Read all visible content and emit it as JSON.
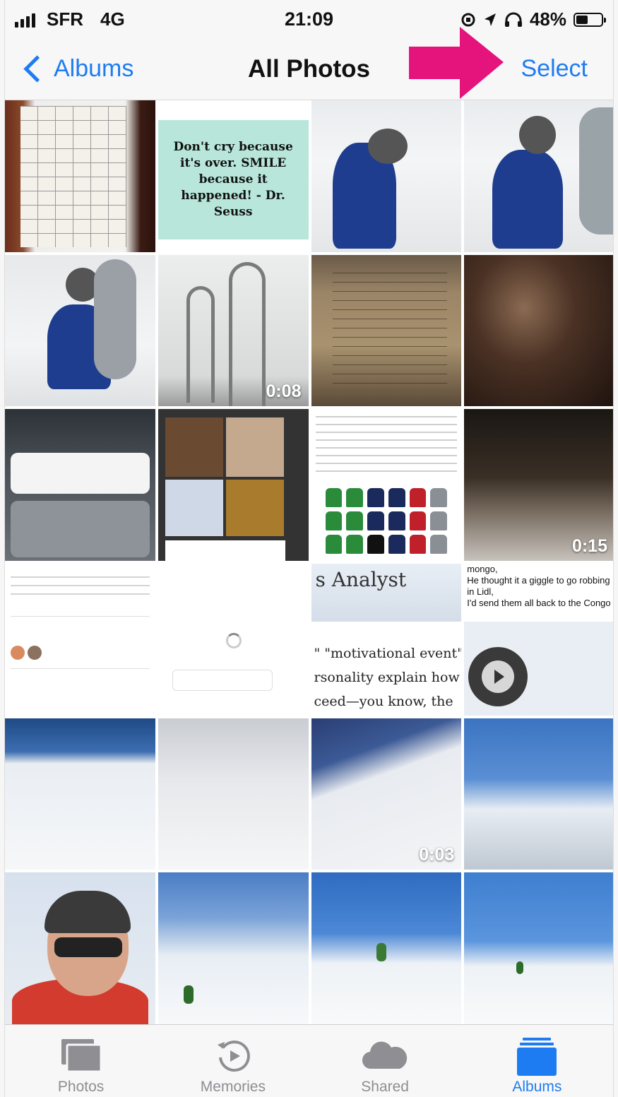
{
  "status_bar": {
    "carrier": "SFR",
    "network": "4G",
    "time": "21:09",
    "battery_percent": "48%",
    "battery_level": 0.48
  },
  "nav": {
    "back_label": "Albums",
    "title": "All Photos",
    "select_label": "Select",
    "arrow_color": "#e5137c"
  },
  "photos": [
    {
      "kind": "photo",
      "desc_icon": "quiz-sheet"
    },
    {
      "kind": "screenshot",
      "quote": "Don't cry because it's over. SMILE because it happened! - Dr. Seuss"
    },
    {
      "kind": "photo"
    },
    {
      "kind": "photo"
    },
    {
      "kind": "photo"
    },
    {
      "kind": "video",
      "duration": "0:08"
    },
    {
      "kind": "photo"
    },
    {
      "kind": "photo"
    },
    {
      "kind": "screenshot"
    },
    {
      "kind": "screenshot"
    },
    {
      "kind": "screenshot"
    },
    {
      "kind": "video",
      "duration": "0:15"
    },
    {
      "kind": "screenshot"
    },
    {
      "kind": "screenshot"
    },
    {
      "kind": "screenshot",
      "banner": "s Analyst",
      "lines": [
        "\" \"motivational event\",",
        "rsonality explain how",
        "ceed—you know, the"
      ]
    },
    {
      "kind": "screenshot",
      "text_lines": [
        "mongo,",
        "He thought it a giggle to go robbing",
        "in Lidl,",
        "I'd send them all back to the Congo"
      ]
    },
    {
      "kind": "photo"
    },
    {
      "kind": "photo"
    },
    {
      "kind": "video",
      "duration": "0:03"
    },
    {
      "kind": "photo"
    },
    {
      "kind": "photo"
    },
    {
      "kind": "photo"
    },
    {
      "kind": "photo"
    },
    {
      "kind": "photo"
    }
  ],
  "tabs": [
    {
      "label": "Photos",
      "icon": "photos-stack-icon",
      "active": false
    },
    {
      "label": "Memories",
      "icon": "memories-icon",
      "active": false
    },
    {
      "label": "Shared",
      "icon": "cloud-icon",
      "active": false
    },
    {
      "label": "Albums",
      "icon": "albums-icon",
      "active": true
    }
  ],
  "colors": {
    "accent": "#1e7cf2",
    "inactive_tab": "#8e8e93"
  }
}
